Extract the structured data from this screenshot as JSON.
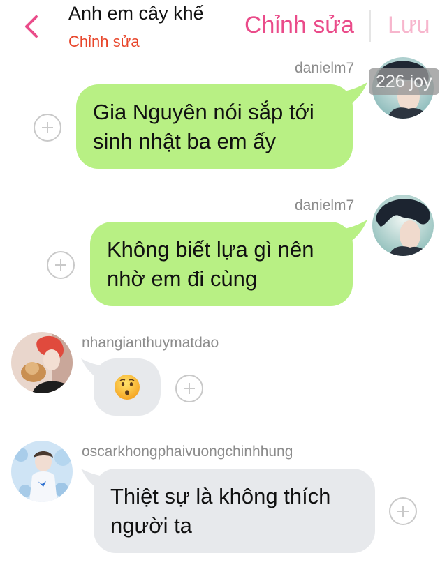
{
  "header": {
    "title": "Anh em cây khế",
    "subtitle": "Chỉnh sửa",
    "edit_label": "Chỉnh sửa",
    "save_label": "Lưu",
    "back_icon": "chevron-left-icon"
  },
  "colors": {
    "accent_pink": "#ea4c8a",
    "accent_pink_disabled": "#f7b6cd",
    "subtitle_red": "#e8462b",
    "outgoing_bubble": "#b8f084",
    "incoming_bubble": "#e7e9ec",
    "username_gray": "#8c8c8c"
  },
  "messages": [
    {
      "direction": "outgoing",
      "username": "danielm7",
      "lines": [
        "Gia Nguyên nói sắp tới",
        "sinh nhật ba em ấy"
      ],
      "badge": "226 joy"
    },
    {
      "direction": "outgoing",
      "username": "danielm7",
      "lines": [
        "Không biết lựa gì nên",
        "nhờ em đi cùng"
      ]
    },
    {
      "direction": "incoming",
      "username": "nhangianthuymatdao",
      "emoji": "hushed-face-emoji"
    },
    {
      "direction": "incoming",
      "username": "oscarkhongphaivuongchinhhung",
      "lines": [
        "Thiệt sự là không thích",
        "người ta"
      ]
    }
  ]
}
